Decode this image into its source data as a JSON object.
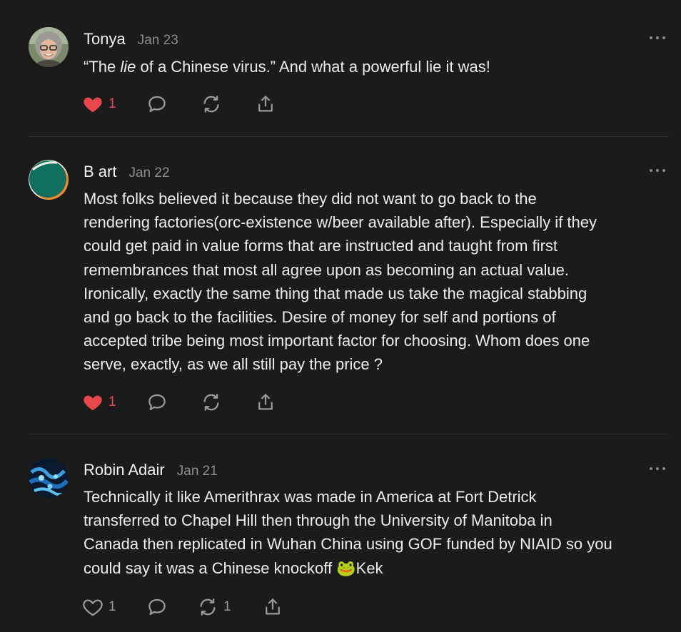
{
  "comments": [
    {
      "author": "Tonya",
      "date": "Jan 23",
      "text_open": "“The ",
      "text_em": "lie",
      "text_close": " of a Chinese virus.” And what a powerful lie it was!",
      "likes": "1",
      "liked": true,
      "restacks": ""
    },
    {
      "author": "B art",
      "date": "Jan 22",
      "text": "Most folks believed it because they did not want to go back to the\nrendering factories(orc-existence w/beer available after). Especially if they\ncould get paid in value forms that are instructed and taught from first\nremembrances that most all agree upon as becoming an actual value.\nIronically, exactly the same thing that made us take the magical stabbing\nand go back to the facilities. Desire of money for self and portions of\naccepted tribe being most important factor for choosing. Whom does one\nserve, exactly, as we all still pay the price ?",
      "likes": "1",
      "liked": true,
      "restacks": ""
    },
    {
      "author": "Robin Adair",
      "date": "Jan 21",
      "text_main": "Technically it like Amerithrax was made in America at Fort Detrick\ntransferred to Chapel Hill then through the University of Manitoba in\nCanada then replicated in Wuhan China using GOF funded by NIAID so you\ncould say it was a Chinese knockoff ",
      "emoji": "🐸",
      "text_end": "Kek",
      "likes": "1",
      "liked": false,
      "restacks": "1"
    }
  ],
  "icons": [
    "heart-icon",
    "comment-icon",
    "restack-icon",
    "share-icon",
    "more-icon"
  ],
  "colors": {
    "background": "#1b1b1c",
    "liked": "#e8474b",
    "muted": "#8c8c8e"
  }
}
